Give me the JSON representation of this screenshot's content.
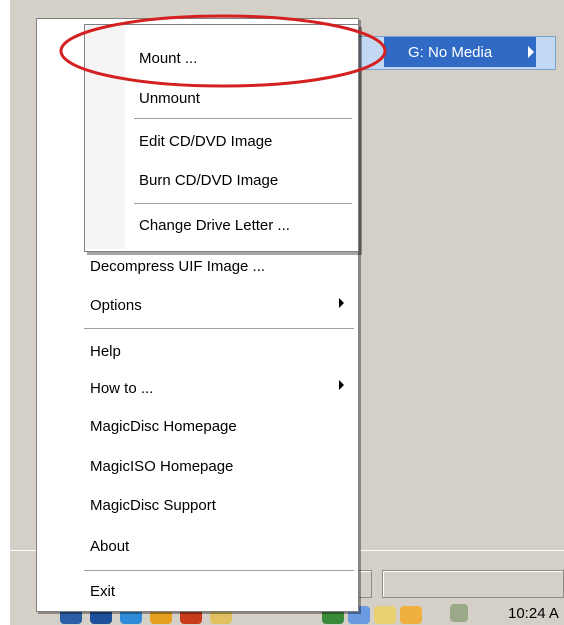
{
  "drive_item": {
    "label": "G: No Media"
  },
  "submenu": {
    "items": [
      {
        "label": "Mount ..."
      },
      {
        "label": "Unmount"
      },
      {
        "label": "Edit CD/DVD Image"
      },
      {
        "label": "Burn CD/DVD Image"
      },
      {
        "label": "Change Drive Letter ..."
      }
    ]
  },
  "main_menu": {
    "items": [
      {
        "label": "Decompress UIF Image ..."
      },
      {
        "label": "Options"
      },
      {
        "label": "Help"
      },
      {
        "label": "How to ..."
      },
      {
        "label": "MagicDisc Homepage"
      },
      {
        "label": "MagicISO Homepage"
      },
      {
        "label": "MagicDisc Support"
      },
      {
        "label": "About"
      },
      {
        "label": "Exit"
      }
    ]
  },
  "taskbar": {
    "clock": "10:24 A"
  },
  "colors": {
    "highlight_ellipse": "#d42020",
    "selected_row": "#316ac5",
    "drive_row_bg": "#c3d9f3"
  }
}
